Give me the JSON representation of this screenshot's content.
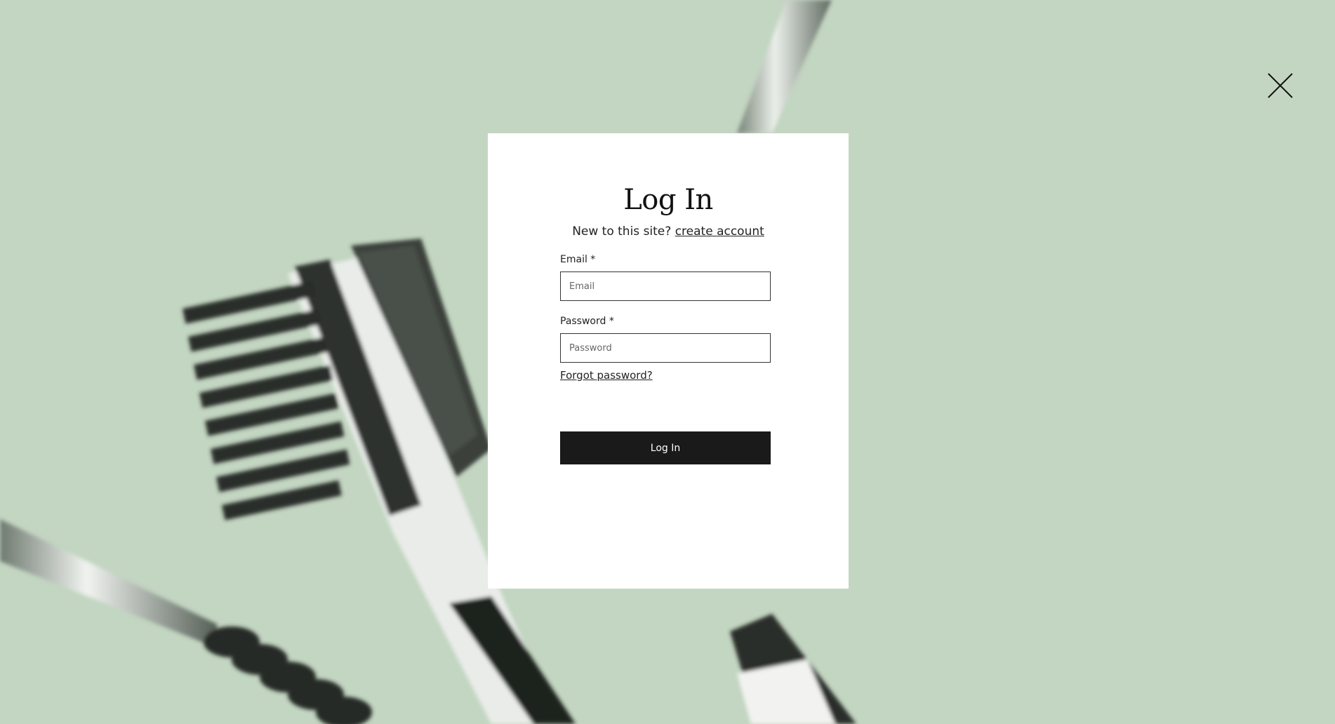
{
  "modal": {
    "title": "Log In",
    "subtitle_text": "New to this site?",
    "create_account_link": "create account",
    "email_label": "Email *",
    "email_placeholder": "Email",
    "email_value": "",
    "password_label": "Password *",
    "password_placeholder": "Password",
    "password_value": "",
    "forgot_password_link": "Forgot password?",
    "submit_label": "Log In"
  },
  "icons": {
    "close": "close-icon"
  },
  "colors": {
    "backdrop": "#c3d6c2",
    "modal_background": "#ffffff",
    "button_background": "#1a1a1a",
    "button_text": "#ffffff",
    "text": "#222222"
  }
}
